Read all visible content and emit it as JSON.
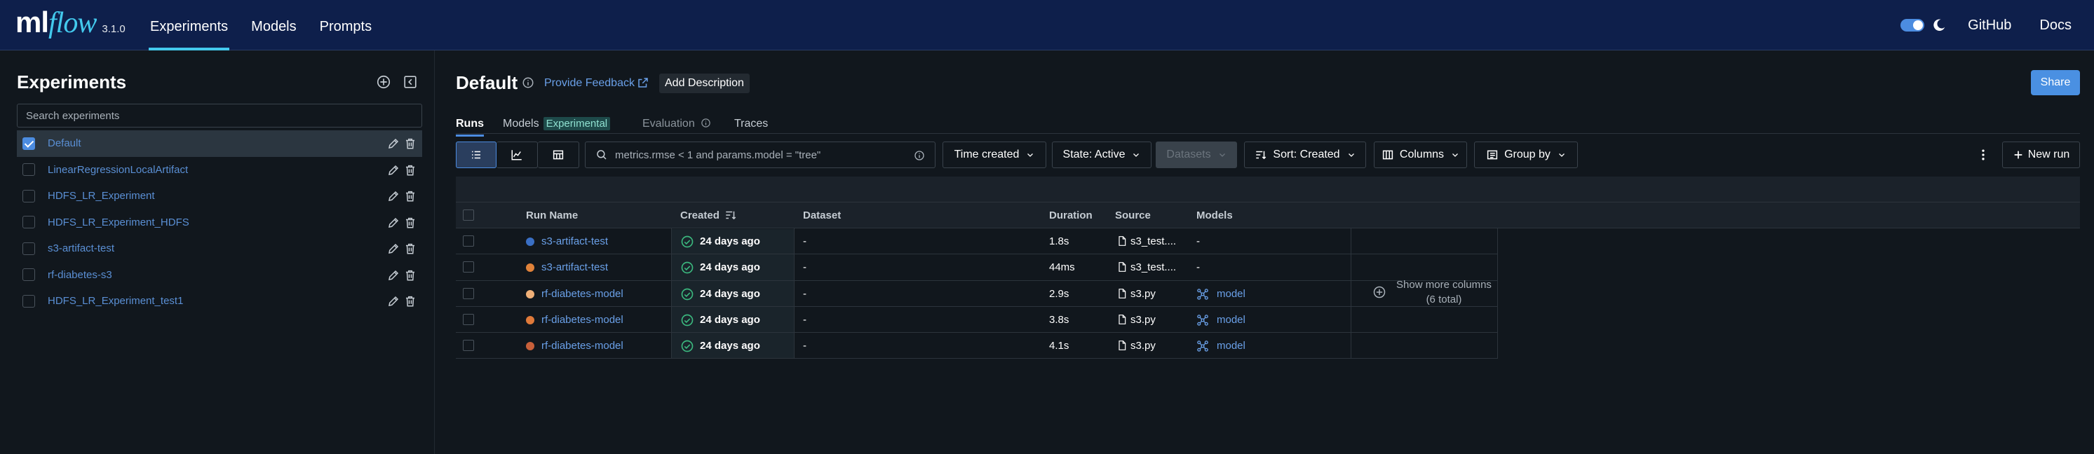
{
  "app": {
    "logo_ml": "ml",
    "logo_flow": "flow",
    "version": "3.1.0",
    "nav": [
      "Experiments",
      "Models",
      "Prompts"
    ],
    "github": "GitHub",
    "docs": "Docs"
  },
  "sidebar": {
    "title": "Experiments",
    "search_placeholder": "Search experiments",
    "experiments": [
      {
        "name": "Default",
        "selected": true
      },
      {
        "name": "LinearRegressionLocalArtifact",
        "selected": false
      },
      {
        "name": "HDFS_LR_Experiment",
        "selected": false
      },
      {
        "name": "HDFS_LR_Experiment_HDFS",
        "selected": false
      },
      {
        "name": "s3-artifact-test",
        "selected": false
      },
      {
        "name": "rf-diabetes-s3",
        "selected": false
      },
      {
        "name": "HDFS_LR_Experiment_test1",
        "selected": false
      }
    ]
  },
  "main": {
    "title": "Default",
    "feedback": "Provide Feedback",
    "add_description": "Add Description",
    "share": "Share",
    "tabs": {
      "runs": "Runs",
      "models": "Models",
      "experimental_tag": "Experimental",
      "evaluation": "Evaluation",
      "traces": "Traces"
    },
    "toolbar": {
      "filter_placeholder": "metrics.rmse < 1 and params.model = \"tree\"",
      "time_created": "Time created",
      "state": "State: Active",
      "datasets": "Datasets",
      "sort": "Sort: Created",
      "columns": "Columns",
      "group_by": "Group by",
      "new_run": "New run"
    },
    "table": {
      "headers": {
        "run_name": "Run Name",
        "created": "Created",
        "dataset": "Dataset",
        "duration": "Duration",
        "source": "Source",
        "models": "Models"
      },
      "rows": [
        {
          "run_name": "s3-artifact-test",
          "color": "#3a6fc4",
          "created": "24 days ago",
          "dataset": "-",
          "duration": "1.8s",
          "source": "s3_test....",
          "models": "-",
          "has_model": false
        },
        {
          "run_name": "s3-artifact-test",
          "color": "#e0823a",
          "created": "24 days ago",
          "dataset": "-",
          "duration": "44ms",
          "source": "s3_test....",
          "models": "-",
          "has_model": false
        },
        {
          "run_name": "rf-diabetes-model",
          "color": "#f0b078",
          "created": "24 days ago",
          "dataset": "-",
          "duration": "2.9s",
          "source": "s3.py",
          "models": "model",
          "has_model": true
        },
        {
          "run_name": "rf-diabetes-model",
          "color": "#e07a3a",
          "created": "24 days ago",
          "dataset": "-",
          "duration": "3.8s",
          "source": "s3.py",
          "models": "model",
          "has_model": true
        },
        {
          "run_name": "rf-diabetes-model",
          "color": "#c8603a",
          "created": "24 days ago",
          "dataset": "-",
          "duration": "4.1s",
          "source": "s3.py",
          "models": "model",
          "has_model": true
        }
      ],
      "show_more": "Show more columns (6 total)"
    }
  }
}
